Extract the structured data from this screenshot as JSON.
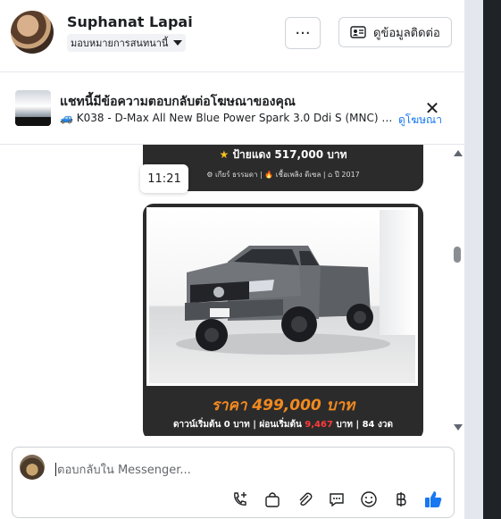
{
  "header": {
    "contact_name": "Suphanat Lapai",
    "assignment_label": "มอบหมายการสนทนานี้",
    "more_label": "···",
    "contact_info_button": "ดูข้อมูลติดต่อ"
  },
  "ad_banner": {
    "title": "แชทนี้มีข้อความตอบกลับต่อโฆษณาของคุณ",
    "ad_description": "🚙 K038 - D-Max All New Blue Power Spark 3.0 Ddi S (MNC) MT* ...",
    "view_ad_link": "ดูโฆษณา",
    "close_symbol": "✕"
  },
  "chat": {
    "card1_price": "ป้ายแดง 517,000 บาท",
    "card1_specs": "⚙ เกียร์ ธรรมดา  |  🔥 เชื้อเพลิง ดีเซล  |  ⌂ ปี 2017",
    "timestamp": "11:21",
    "card2_price": "ราคา 499,000 บาท",
    "card2_finance_prefix": "ดาวน์เริ่มต้น 0 บาท | ผ่อนเริ่มต้น",
    "card2_finance_amount": "9,467",
    "card2_finance_suffix": "บาท | 84 งวด"
  },
  "composer": {
    "placeholder": "ตอบกลับใน Messenger...",
    "tools": [
      "phone-plus-icon",
      "shopping-bag-icon",
      "paperclip-icon",
      "saved-replies-icon",
      "emoji-icon",
      "baht-icon",
      "thumbs-up-icon"
    ]
  },
  "colors": {
    "accent": "#1877f2",
    "price_orange": "#f28a20",
    "finance_red": "#ff3b3b",
    "card_bg": "#2b2b2b"
  }
}
